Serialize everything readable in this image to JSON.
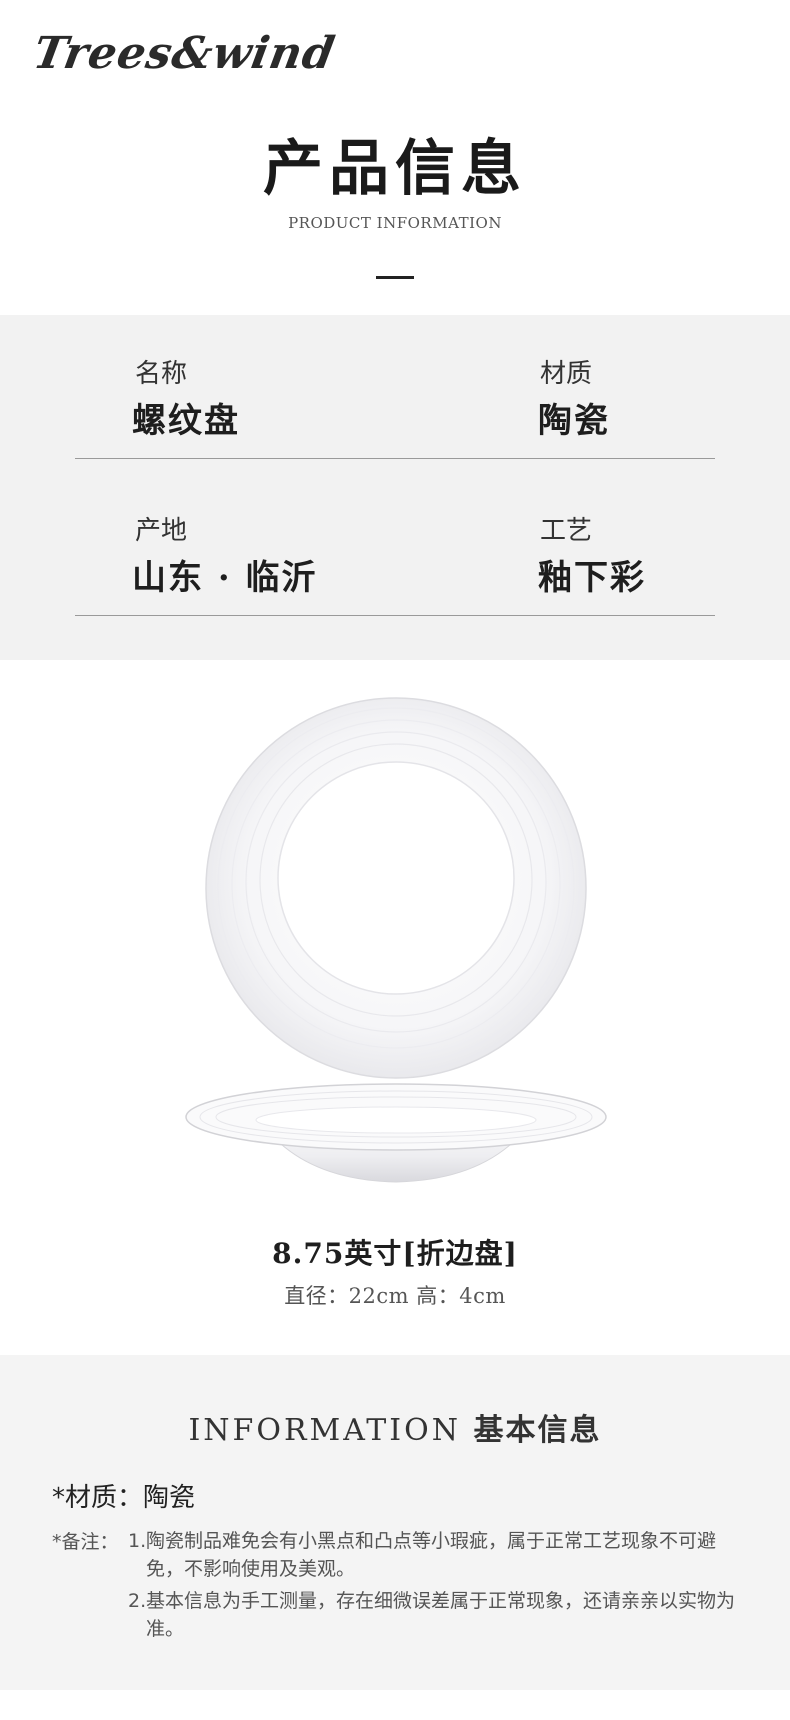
{
  "header": {
    "logo": "Trees&wind",
    "title": "产品信息",
    "subtitle": "PRODUCT INFORMATION"
  },
  "info": [
    {
      "label": "名称",
      "value": "螺纹盘"
    },
    {
      "label": "材质",
      "value": "陶瓷"
    },
    {
      "label": "产地",
      "value": "山东 · 临沂"
    },
    {
      "label": "工艺",
      "value": "釉下彩"
    }
  ],
  "product": {
    "name": "8.75英寸[折边盘]",
    "dimensions": "直径：22cm 高：4cm"
  },
  "basic": {
    "heading_en": "INFORMATION",
    "heading_zh": "基本信息",
    "material": "*材质：陶瓷",
    "note_label": "*备注：",
    "notes": [
      {
        "num": "1.",
        "text": "陶瓷制品难免会有小黑点和凸点等小瑕疵，属于正常工艺现象不可避免，不影响使用及美观。"
      },
      {
        "num": "2.",
        "text": "基本信息为手工测量，存在细微误差属于正常现象，还请亲亲以实物为准。"
      }
    ]
  },
  "colors": {
    "page_bg": "#ffffff",
    "section_bg": "#f2f2f2",
    "text_dark": "#1e1e1e",
    "text_muted": "#555555",
    "divider": "#9a9a9a"
  }
}
